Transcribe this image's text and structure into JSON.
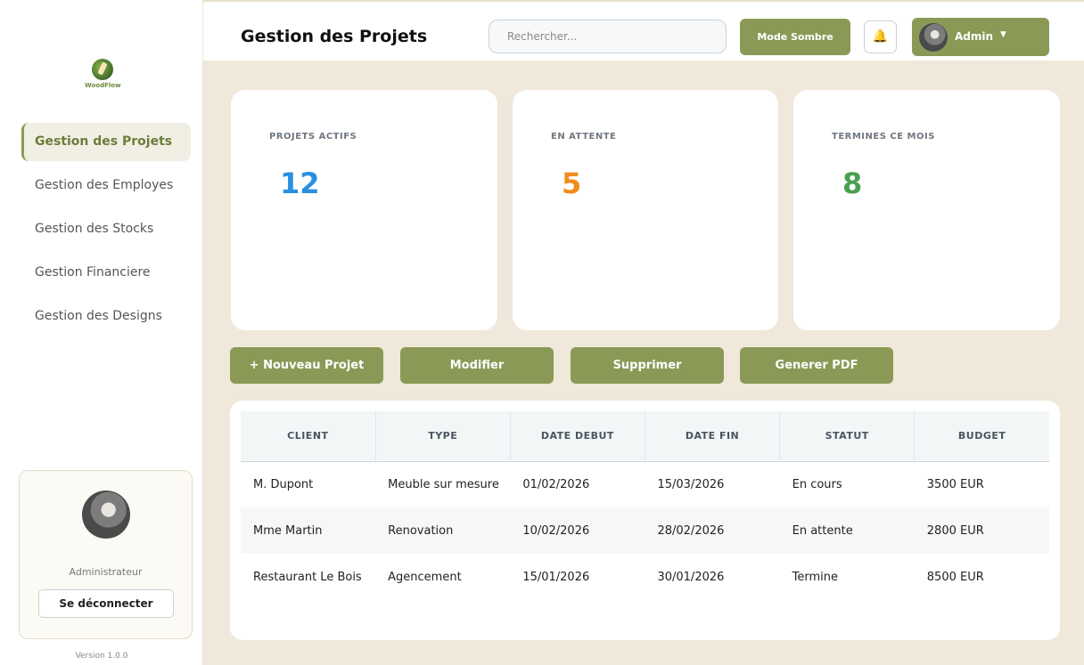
{
  "brand": {
    "logo_text": "WoodFlow"
  },
  "header": {
    "title": "Gestion des Projets",
    "search_placeholder": "Rechercher...",
    "dark_mode_label": "Mode Sombre",
    "bell_icon": "bell-icon",
    "user_label": "Admin",
    "caret": "▼"
  },
  "sidebar": {
    "items": [
      {
        "label": "Gestion des Projets",
        "active": true
      },
      {
        "label": "Gestion des Employes",
        "active": false
      },
      {
        "label": "Gestion des Stocks",
        "active": false
      },
      {
        "label": "Gestion Financiere",
        "active": false
      },
      {
        "label": "Gestion des Designs",
        "active": false
      }
    ],
    "profile": {
      "role": "Administrateur",
      "logout_label": "Se déconnecter"
    },
    "version": "Version 1.0.0"
  },
  "stats": [
    {
      "label": "PROJETS ACTIFS",
      "value": "12",
      "color": "#2b8fe0"
    },
    {
      "label": "EN ATTENTE",
      "value": "5",
      "color": "#f08c1c"
    },
    {
      "label": "TERMINES CE MOIS",
      "value": "8",
      "color": "#4aa050"
    }
  ],
  "actions": {
    "new": "+ Nouveau Projet",
    "edit": "Modifier",
    "delete": "Supprimer",
    "pdf": "Generer PDF"
  },
  "table": {
    "headers": [
      "CLIENT",
      "TYPE",
      "DATE DEBUT",
      "DATE FIN",
      "STATUT",
      "BUDGET"
    ],
    "rows": [
      [
        "M. Dupont",
        "Meuble sur mesure",
        "01/02/2026",
        "15/03/2026",
        "En cours",
        "3500 EUR"
      ],
      [
        "Mme Martin",
        "Renovation",
        "10/02/2026",
        "28/02/2026",
        "En attente",
        "2800 EUR"
      ],
      [
        "Restaurant Le Bois",
        "Agencement",
        "15/01/2026",
        "30/01/2026",
        "Termine",
        "8500 EUR"
      ]
    ]
  },
  "colors": {
    "accent": "#8a9a56",
    "background": "#f0e8da"
  }
}
